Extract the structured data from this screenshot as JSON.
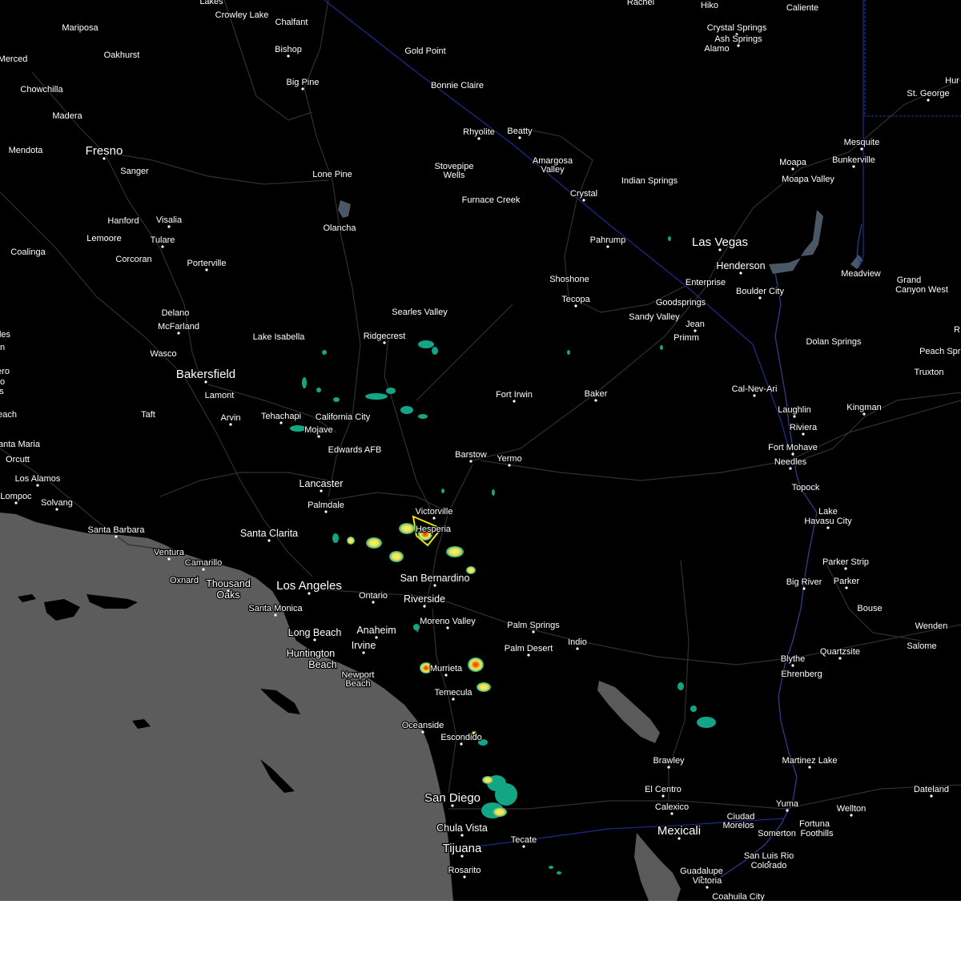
{
  "map": {
    "colors": {
      "land": "#000000",
      "ocean": "#5c5c5c",
      "roads": "#2e2e2e",
      "state_border": "#1d2a8c",
      "water": "#4a5a6a",
      "warning_polygon": "#f2e500"
    },
    "places": [
      {
        "name": "Lakes",
        "size": "sm"
      },
      {
        "name": "Crowley Lake",
        "size": "sm"
      },
      {
        "name": "Chalfant",
        "size": "sm"
      },
      {
        "name": "Bishop",
        "size": "sm"
      },
      {
        "name": "Big Pine",
        "size": "sm"
      },
      {
        "name": "Mariposa",
        "size": "sm"
      },
      {
        "name": "Oakhurst",
        "size": "sm"
      },
      {
        "name": "Merced",
        "size": "sm"
      },
      {
        "name": "Chowchilla",
        "size": "sm"
      },
      {
        "name": "Madera",
        "size": "sm"
      },
      {
        "name": "Mendota",
        "size": "sm"
      },
      {
        "name": "Fresno",
        "size": "lg"
      },
      {
        "name": "Sanger",
        "size": "sm"
      },
      {
        "name": "Hanford",
        "size": "sm"
      },
      {
        "name": "Visalia",
        "size": "sm"
      },
      {
        "name": "Lemoore",
        "size": "sm"
      },
      {
        "name": "Tulare",
        "size": "sm"
      },
      {
        "name": "Coalinga",
        "size": "sm"
      },
      {
        "name": "Corcoran",
        "size": "sm"
      },
      {
        "name": "Porterville",
        "size": "sm"
      },
      {
        "name": "Delano",
        "size": "sm"
      },
      {
        "name": "McFarland",
        "size": "sm"
      },
      {
        "name": "Wasco",
        "size": "sm"
      },
      {
        "name": "Bakersfield",
        "size": "lg"
      },
      {
        "name": "Lamont",
        "size": "sm"
      },
      {
        "name": "Arvin",
        "size": "sm"
      },
      {
        "name": "Taft",
        "size": "sm"
      },
      {
        "name": "Tehachapi",
        "size": "sm"
      },
      {
        "name": "Mojave",
        "size": "sm"
      },
      {
        "name": "California City",
        "size": "sm"
      },
      {
        "name": "Edwards AFB",
        "size": "sm"
      },
      {
        "name": "Lake Isabella",
        "size": "sm"
      },
      {
        "name": "Ridgecrest",
        "size": "sm"
      },
      {
        "name": "Searles Valley",
        "size": "sm"
      },
      {
        "name": "Lone Pine",
        "size": "sm"
      },
      {
        "name": "Olancha",
        "size": "sm"
      },
      {
        "name": "Gold Point",
        "size": "sm"
      },
      {
        "name": "Bonnie Claire",
        "size": "sm"
      },
      {
        "name": "Rhyolite",
        "size": "sm"
      },
      {
        "name": "Beatty",
        "size": "sm"
      },
      {
        "name": "Stovepipe",
        "size": "sm"
      },
      {
        "name": "Wells",
        "size": "sm"
      },
      {
        "name": "Furnace Creek",
        "size": "sm"
      },
      {
        "name": "Amargosa",
        "size": "sm"
      },
      {
        "name": "Valley",
        "size": "sm"
      },
      {
        "name": "Crystal",
        "size": "sm"
      },
      {
        "name": "Indian Springs",
        "size": "sm"
      },
      {
        "name": "Pahrump",
        "size": "sm"
      },
      {
        "name": "Shoshone",
        "size": "sm"
      },
      {
        "name": "Tecopa",
        "size": "sm"
      },
      {
        "name": "Rachel",
        "size": "sm"
      },
      {
        "name": "Hiko",
        "size": "sm"
      },
      {
        "name": "Caliente",
        "size": "sm"
      },
      {
        "name": "Crystal Springs",
        "size": "sm"
      },
      {
        "name": "Ash Springs",
        "size": "sm"
      },
      {
        "name": "Alamo",
        "size": "sm"
      },
      {
        "name": "St. George",
        "size": "sm"
      },
      {
        "name": "Hur",
        "size": "sm"
      },
      {
        "name": "Mesquite",
        "size": "sm"
      },
      {
        "name": "Bunkerville",
        "size": "sm"
      },
      {
        "name": "Moapa",
        "size": "sm"
      },
      {
        "name": "Moapa Valley",
        "size": "sm"
      },
      {
        "name": "Las Vegas",
        "size": "lg"
      },
      {
        "name": "Henderson",
        "size": "md"
      },
      {
        "name": "Enterprise",
        "size": "sm"
      },
      {
        "name": "Boulder City",
        "size": "sm"
      },
      {
        "name": "Meadview",
        "size": "sm"
      },
      {
        "name": "Grand",
        "size": "sm"
      },
      {
        "name": "Canyon West",
        "size": "sm"
      },
      {
        "name": "Goodsprings",
        "size": "sm"
      },
      {
        "name": "Sandy Valley",
        "size": "sm"
      },
      {
        "name": "Jean",
        "size": "sm"
      },
      {
        "name": "Primm",
        "size": "sm"
      },
      {
        "name": "Dolan Springs",
        "size": "sm"
      },
      {
        "name": "Peach Spri",
        "size": "sm"
      },
      {
        "name": "Truxton",
        "size": "sm"
      },
      {
        "name": "Fort Irwin",
        "size": "sm"
      },
      {
        "name": "Baker",
        "size": "sm"
      },
      {
        "name": "Cal-Nev-Ari",
        "size": "sm"
      },
      {
        "name": "Laughlin",
        "size": "sm"
      },
      {
        "name": "Riviera",
        "size": "sm"
      },
      {
        "name": "Fort Mohave",
        "size": "sm"
      },
      {
        "name": "Needles",
        "size": "sm"
      },
      {
        "name": "Kingman",
        "size": "sm"
      },
      {
        "name": "Topock",
        "size": "sm"
      },
      {
        "name": "Lake",
        "size": "sm"
      },
      {
        "name": "Havasu City",
        "size": "sm"
      },
      {
        "name": "Parker Strip",
        "size": "sm"
      },
      {
        "name": "Big River",
        "size": "sm"
      },
      {
        "name": "Parker",
        "size": "sm"
      },
      {
        "name": "Bouse",
        "size": "sm"
      },
      {
        "name": "Wenden",
        "size": "sm"
      },
      {
        "name": "Salome",
        "size": "sm"
      },
      {
        "name": "Quartzsite",
        "size": "sm"
      },
      {
        "name": "Blythe",
        "size": "sm"
      },
      {
        "name": "Ehrenberg",
        "size": "sm"
      },
      {
        "name": "Barstow",
        "size": "sm"
      },
      {
        "name": "Yermo",
        "size": "sm"
      },
      {
        "name": "Lancaster",
        "size": "md"
      },
      {
        "name": "Palmdale",
        "size": "sm"
      },
      {
        "name": "Victorville",
        "size": "sm"
      },
      {
        "name": "Hesperia",
        "size": "sm"
      },
      {
        "name": "Santa Clarita",
        "size": "md"
      },
      {
        "name": "San Bernardino",
        "size": "md"
      },
      {
        "name": "Los Angeles",
        "size": "lg"
      },
      {
        "name": "Ontario",
        "size": "sm"
      },
      {
        "name": "Riverside",
        "size": "md"
      },
      {
        "name": "Moreno Valley",
        "size": "sm"
      },
      {
        "name": "Palm Springs",
        "size": "sm"
      },
      {
        "name": "Palm Desert",
        "size": "sm"
      },
      {
        "name": "Indio",
        "size": "sm"
      },
      {
        "name": "Santa Monica",
        "size": "sm"
      },
      {
        "name": "Long Beach",
        "size": "md"
      },
      {
        "name": "Anaheim",
        "size": "md"
      },
      {
        "name": "Irvine",
        "size": "md"
      },
      {
        "name": "Huntington",
        "size": "md"
      },
      {
        "name": "Beach",
        "size": "md"
      },
      {
        "name": "Newport",
        "size": "sm"
      },
      {
        "name": "Beach",
        "size": "sm"
      },
      {
        "name": "Murrieta",
        "size": "sm"
      },
      {
        "name": "Temecula",
        "size": "sm"
      },
      {
        "name": "Oceanside",
        "size": "sm"
      },
      {
        "name": "Escondido",
        "size": "sm"
      },
      {
        "name": "San Diego",
        "size": "lg"
      },
      {
        "name": "Chula Vista",
        "size": "md"
      },
      {
        "name": "Tijuana",
        "size": "lg"
      },
      {
        "name": "Rosarito",
        "size": "sm"
      },
      {
        "name": "Tecate",
        "size": "sm"
      },
      {
        "name": "Brawley",
        "size": "sm"
      },
      {
        "name": "El Centro",
        "size": "sm"
      },
      {
        "name": "Calexico",
        "size": "sm"
      },
      {
        "name": "Mexicali",
        "size": "lg"
      },
      {
        "name": "Ciudad",
        "size": "sm"
      },
      {
        "name": "Morelos",
        "size": "sm"
      },
      {
        "name": "Yuma",
        "size": "sm"
      },
      {
        "name": "Somerton",
        "size": "sm"
      },
      {
        "name": "Fortuna",
        "size": "sm"
      },
      {
        "name": "Foothills",
        "size": "sm"
      },
      {
        "name": "Wellton",
        "size": "sm"
      },
      {
        "name": "Dateland",
        "size": "sm"
      },
      {
        "name": "Martinez Lake",
        "size": "sm"
      },
      {
        "name": "San Luis Rio",
        "size": "sm"
      },
      {
        "name": "Colorado",
        "size": "sm"
      },
      {
        "name": "Guadalupe",
        "size": "sm"
      },
      {
        "name": "Victoria",
        "size": "sm"
      },
      {
        "name": "Coahuila City",
        "size": "sm"
      },
      {
        "name": "Ventura",
        "size": "sm"
      },
      {
        "name": "Camarillo",
        "size": "sm"
      },
      {
        "name": "Oxnard",
        "size": "sm"
      },
      {
        "name": "Thousand",
        "size": "md"
      },
      {
        "name": "Oaks",
        "size": "md"
      },
      {
        "name": "Santa Barbara",
        "size": "sm"
      },
      {
        "name": "Solvang",
        "size": "sm"
      },
      {
        "name": "Lompoc",
        "size": "sm"
      },
      {
        "name": "Los Alamos",
        "size": "sm"
      },
      {
        "name": "Orcutt",
        "size": "sm"
      },
      {
        "name": "anta Maria",
        "size": "sm"
      },
      {
        "name": "each",
        "size": "sm"
      },
      {
        "name": "les",
        "size": "sm"
      },
      {
        "name": "n",
        "size": "sm"
      },
      {
        "name": "ero",
        "size": "sm"
      },
      {
        "name": "o",
        "size": "sm"
      },
      {
        "name": "s",
        "size": "sm"
      },
      {
        "name": "R",
        "size": "sm"
      }
    ]
  }
}
